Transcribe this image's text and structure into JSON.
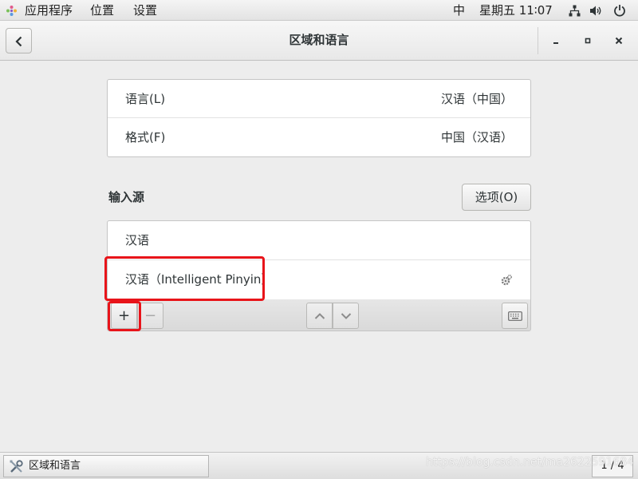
{
  "topbar": {
    "apps": "应用程序",
    "places": "位置",
    "settings": "设置",
    "input_indicator": "中",
    "clock": "星期五 11∶07"
  },
  "header": {
    "title": "区域和语言"
  },
  "language_panel": {
    "rows": [
      {
        "label": "语言(L)",
        "value": "汉语（中国）"
      },
      {
        "label": "格式(F)",
        "value": "中国（汉语）"
      }
    ]
  },
  "input_sources": {
    "title": "输入源",
    "options_label": "选项(O)",
    "items": [
      {
        "label": "汉语"
      },
      {
        "label": "汉语（Intelligent Pinyin）"
      }
    ],
    "add_label": "+",
    "remove_label": "−"
  },
  "taskbar": {
    "window_label": "区域和语言",
    "pager": "1 / 4"
  },
  "watermark": "https://blog.csdn.net/ma2622591684",
  "colors": {
    "highlight": "#e8141a",
    "background": "#ededed"
  }
}
